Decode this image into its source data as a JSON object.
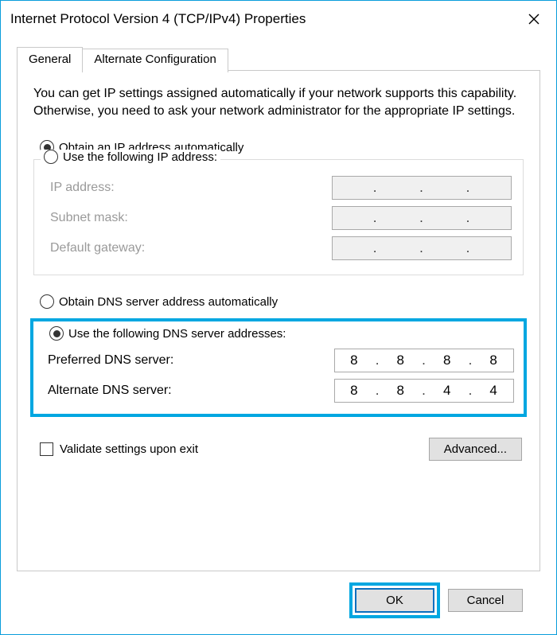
{
  "window": {
    "title": "Internet Protocol Version 4 (TCP/IPv4) Properties"
  },
  "tabs": {
    "general": "General",
    "alternate": "Alternate Configuration"
  },
  "intro": "You can get IP settings assigned automatically if your network supports this capability. Otherwise, you need to ask your network administrator for the appropriate IP settings.",
  "ip": {
    "auto_label": "Obtain an IP address automatically",
    "manual_label": "Use the following IP address:",
    "ip_label": "IP address:",
    "subnet_label": "Subnet mask:",
    "gateway_label": "Default gateway:",
    "ip_value": [
      "",
      "",
      "",
      ""
    ],
    "subnet_value": [
      "",
      "",
      "",
      ""
    ],
    "gateway_value": [
      "",
      "",
      "",
      ""
    ]
  },
  "dns": {
    "auto_label": "Obtain DNS server address automatically",
    "manual_label": "Use the following DNS server addresses:",
    "preferred_label": "Preferred DNS server:",
    "alternate_label": "Alternate DNS server:",
    "preferred_value": [
      "8",
      "8",
      "8",
      "8"
    ],
    "alternate_value": [
      "8",
      "8",
      "4",
      "4"
    ]
  },
  "validate_label": "Validate settings upon exit",
  "buttons": {
    "advanced": "Advanced...",
    "ok": "OK",
    "cancel": "Cancel"
  }
}
